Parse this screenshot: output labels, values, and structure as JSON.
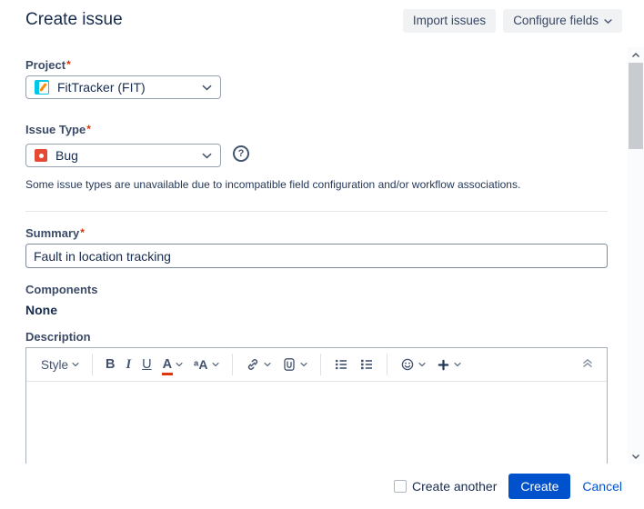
{
  "header": {
    "title": "Create issue",
    "import_button": "Import issues",
    "configure_button": "Configure fields"
  },
  "required_mark": "*",
  "form": {
    "project": {
      "label": "Project",
      "value": "FitTracker (FIT)"
    },
    "issue_type": {
      "label": "Issue Type",
      "value": "Bug",
      "help_glyph": "?",
      "note": "Some issue types are unavailable due to incompatible field configuration and/or workflow associations."
    },
    "summary": {
      "label": "Summary",
      "value": "Fault in location tracking"
    },
    "components": {
      "label": "Components",
      "value": "None"
    },
    "description": {
      "label": "Description",
      "toolbar": {
        "style": "Style",
        "bold": "B",
        "italic": "I",
        "underline": "U",
        "text_color": "A",
        "case": "ᵃA"
      }
    }
  },
  "footer": {
    "create_another": "Create another",
    "create": "Create",
    "cancel": "Cancel"
  },
  "colors": {
    "primary": "#0052CC",
    "danger": "#DE350B",
    "bug": "#E34935",
    "project_avatar_bg": "#00C7E6",
    "project_pencil": "#FF8B00"
  }
}
